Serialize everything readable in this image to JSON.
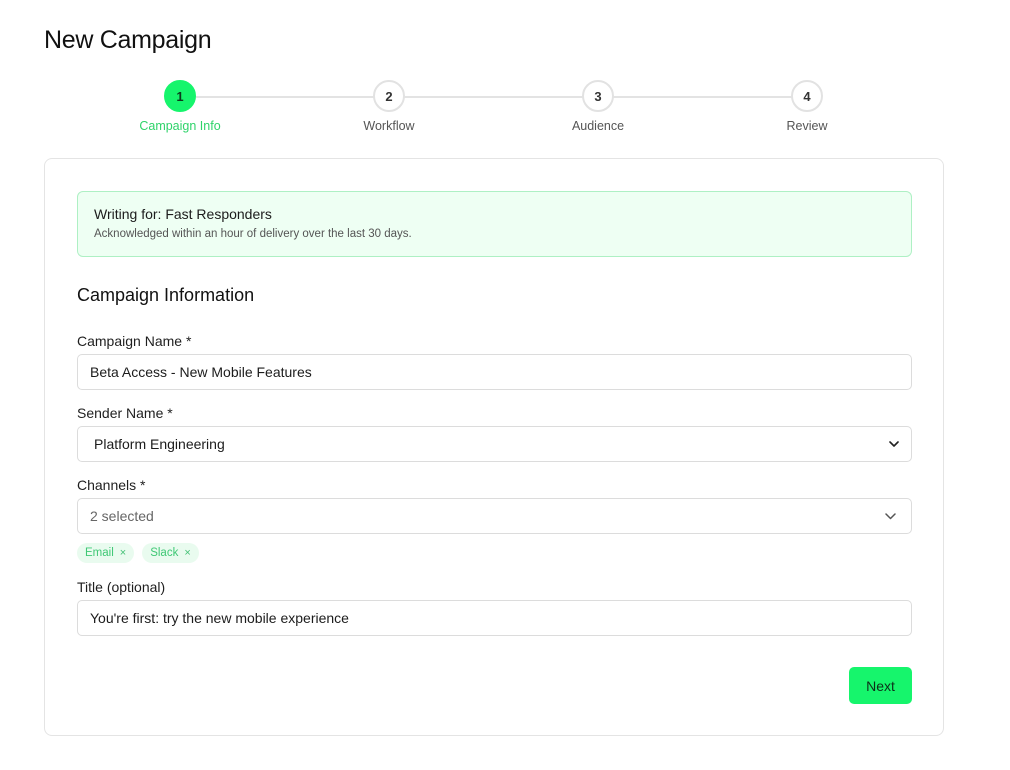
{
  "page": {
    "title": "New Campaign"
  },
  "stepper": {
    "steps": [
      {
        "number": "1",
        "label": "Campaign Info",
        "active": true
      },
      {
        "number": "2",
        "label": "Workflow",
        "active": false
      },
      {
        "number": "3",
        "label": "Audience",
        "active": false
      },
      {
        "number": "4",
        "label": "Review",
        "active": false
      }
    ]
  },
  "notice": {
    "title": "Writing for: Fast Responders",
    "subtitle": "Acknowledged within an hour of delivery over the last 30 days."
  },
  "form": {
    "section_title": "Campaign Information",
    "campaign_name": {
      "label": "Campaign Name *",
      "value": "Beta Access - New Mobile Features"
    },
    "sender_name": {
      "label": "Sender Name *",
      "value": "Platform Engineering"
    },
    "channels": {
      "label": "Channels *",
      "summary": "2 selected",
      "tags": [
        "Email",
        "Slack"
      ],
      "tag_remove": "×"
    },
    "title": {
      "label": "Title (optional)",
      "value": "You're first: try the new mobile experience"
    }
  },
  "actions": {
    "next_label": "Next"
  },
  "colors": {
    "accent": "#16f56c",
    "accent_text": "#2fd36a",
    "notice_bg": "#eefff3",
    "notice_border": "#aef0c4"
  }
}
